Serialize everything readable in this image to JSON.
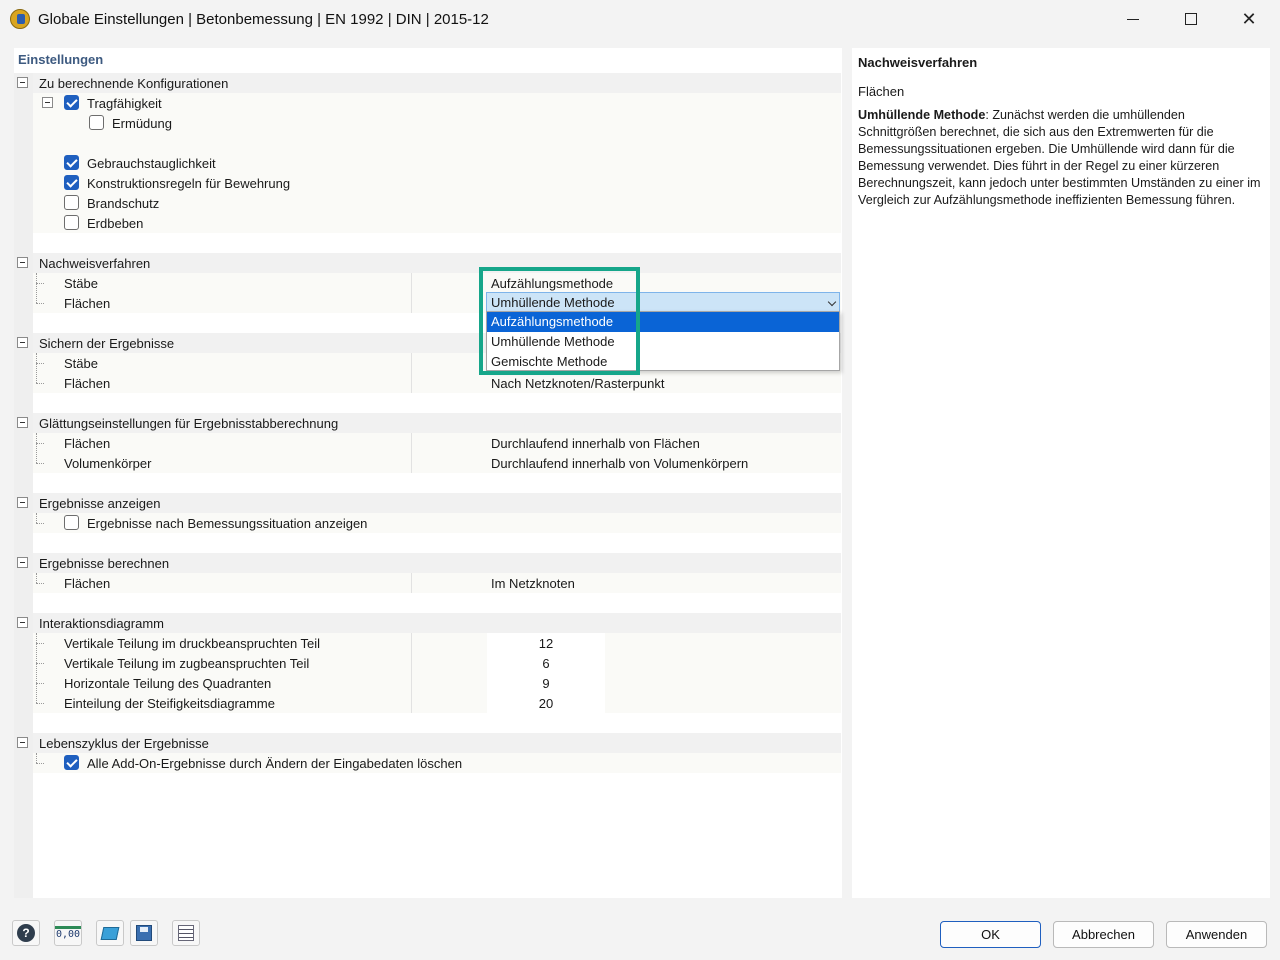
{
  "window": {
    "title": "Globale Einstellungen | Betonbemessung | EN 1992 | DIN | 2015-12"
  },
  "left": {
    "header": "Einstellungen",
    "sections": {
      "konfig": {
        "label": "Zu berechnende Konfigurationen",
        "items": {
          "tragfaehigkeit": {
            "label": "Tragfähigkeit",
            "checked": true
          },
          "ermuedung": {
            "label": "Ermüdung",
            "checked": false
          },
          "gebrauch": {
            "label": "Gebrauchstauglichkeit",
            "checked": true
          },
          "konstruktion": {
            "label": "Konstruktionsregeln für Bewehrung",
            "checked": true
          },
          "brandschutz": {
            "label": "Brandschutz",
            "checked": false
          },
          "erdbeben": {
            "label": "Erdbeben",
            "checked": false
          }
        }
      },
      "nachweis": {
        "label": "Nachweisverfahren",
        "staebe_label": "Stäbe",
        "staebe_value": "Aufzählungsmethode",
        "flaechen_label": "Flächen",
        "flaechen_value": "Umhüllende Methode",
        "options": [
          "Aufzählungsmethode",
          "Umhüllende Methode",
          "Gemischte Methode"
        ],
        "selected_option": "Aufzählungsmethode"
      },
      "sichern": {
        "label": "Sichern der Ergebnisse",
        "staebe_label": "Stäbe",
        "flaechen_label": "Flächen",
        "flaechen_value": "Nach Netzknoten/Rasterpunkt"
      },
      "glaettung": {
        "label": "Glättungseinstellungen für Ergebnisstabberechnung",
        "flaechen_label": "Flächen",
        "flaechen_value": "Durchlaufend innerhalb von Flächen",
        "volumen_label": "Volumenkörper",
        "volumen_value": "Durchlaufend innerhalb von Volumenkörpern"
      },
      "anzeigen": {
        "label": "Ergebnisse anzeigen",
        "item": {
          "label": "Ergebnisse nach Bemessungssituation anzeigen",
          "checked": false
        }
      },
      "berechnen": {
        "label": "Ergebnisse berechnen",
        "flaechen_label": "Flächen",
        "flaechen_value": "Im Netzknoten"
      },
      "interaktion": {
        "label": "Interaktionsdiagramm",
        "rows": [
          {
            "label": "Vertikale Teilung im druckbeanspruchten Teil",
            "value": "12"
          },
          {
            "label": "Vertikale Teilung im zugbeanspruchten Teil",
            "value": "6"
          },
          {
            "label": "Horizontale Teilung des Quadranten",
            "value": "9"
          },
          {
            "label": "Einteilung der Steifigkeitsdiagramme",
            "value": "20"
          }
        ]
      },
      "lebenszyklus": {
        "label": "Lebenszyklus der Ergebnisse",
        "item": {
          "label": "Alle Add-On-Ergebnisse durch Ändern der Eingabedaten löschen",
          "checked": true
        }
      }
    }
  },
  "right": {
    "title": "Nachweisverfahren",
    "subtitle": "Flächen",
    "body_bold": "Umhüllende Methode",
    "body_text": ": Zunächst werden die umhüllenden Schnittgrößen berechnet, die sich aus den Extremwerten für die Bemessungssituationen ergeben. Die Umhüllende wird dann für die Bemessung verwendet. Dies führt in der Regel zu einer kürzeren Berechnungszeit, kann jedoch unter bestimmten Umständen zu einer im Vergleich zur Aufzählungsmethode ineffizienten Bemessung führen."
  },
  "toolbar": {
    "icons": [
      "help-icon",
      "numeric-format-icon",
      "model-view-icon",
      "save-defaults-icon",
      "list-settings-icon"
    ],
    "num_icon_text": "0,00",
    "help_icon_text": "?"
  },
  "buttons": {
    "ok": "OK",
    "cancel": "Abbrechen",
    "apply": "Anwenden"
  },
  "colors": {
    "accent": "#1f5fbf",
    "highlight_frame": "#16a68a",
    "selected_option": "#0a64d6",
    "combo_bg": "#cce4f7",
    "header_text": "#3d5a80"
  }
}
